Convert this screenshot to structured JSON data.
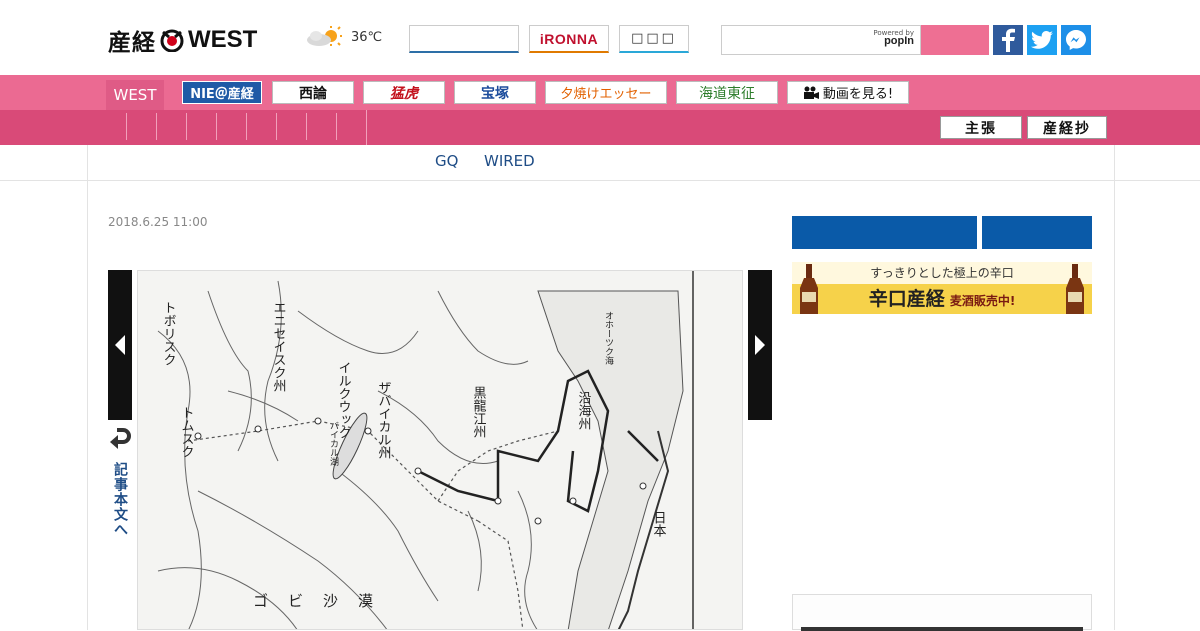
{
  "header": {
    "logo_ja": "産経",
    "logo_en": "WEST",
    "weather": {
      "icon": "partly-sunny-icon",
      "temperature": "36℃"
    },
    "ironna_label": "iRONNA",
    "btn3_label": "□□□",
    "search": {
      "placeholder": "",
      "powered_by": "Powered by",
      "provider": "popIn"
    }
  },
  "nav": {
    "current": "WEST",
    "tabs": [
      "NIE＠産経",
      "西論",
      "猛虎",
      "宝塚",
      "夕焼けエッセー",
      "海道東征",
      "動画を見る!"
    ],
    "sub_tabs": [
      "主張",
      "産経抄"
    ]
  },
  "links": [
    "GQ",
    "WIRED"
  ],
  "article": {
    "date": "2018.6.25 11:00",
    "to_body_label": "記事本文へ",
    "map_labels": {
      "tobolsk": "トボリスク",
      "tomsk": "トムスク",
      "yenisei": "エニセイスク州",
      "irkutsk": "イルクウック",
      "zabaikal": "ザバイカル州",
      "kokuryuko": "黒龍江州",
      "enkaishu": "沿海州",
      "nihon": "日本",
      "gobi": "ゴビ沙漠",
      "baikal": "バイカル湖",
      "sakhalin_sea": "オホーツク海"
    }
  },
  "sidebar": {
    "banner_top": "すっきりとした極上の辛口",
    "banner_main": "辛口産経",
    "banner_sub": "麦酒販売中!"
  },
  "colors": {
    "nav_pink": "#eb6a92",
    "nav_dark_pink": "#d94a78",
    "link_blue": "#1f4d86",
    "sidebar_blue": "#0a5aa8"
  }
}
